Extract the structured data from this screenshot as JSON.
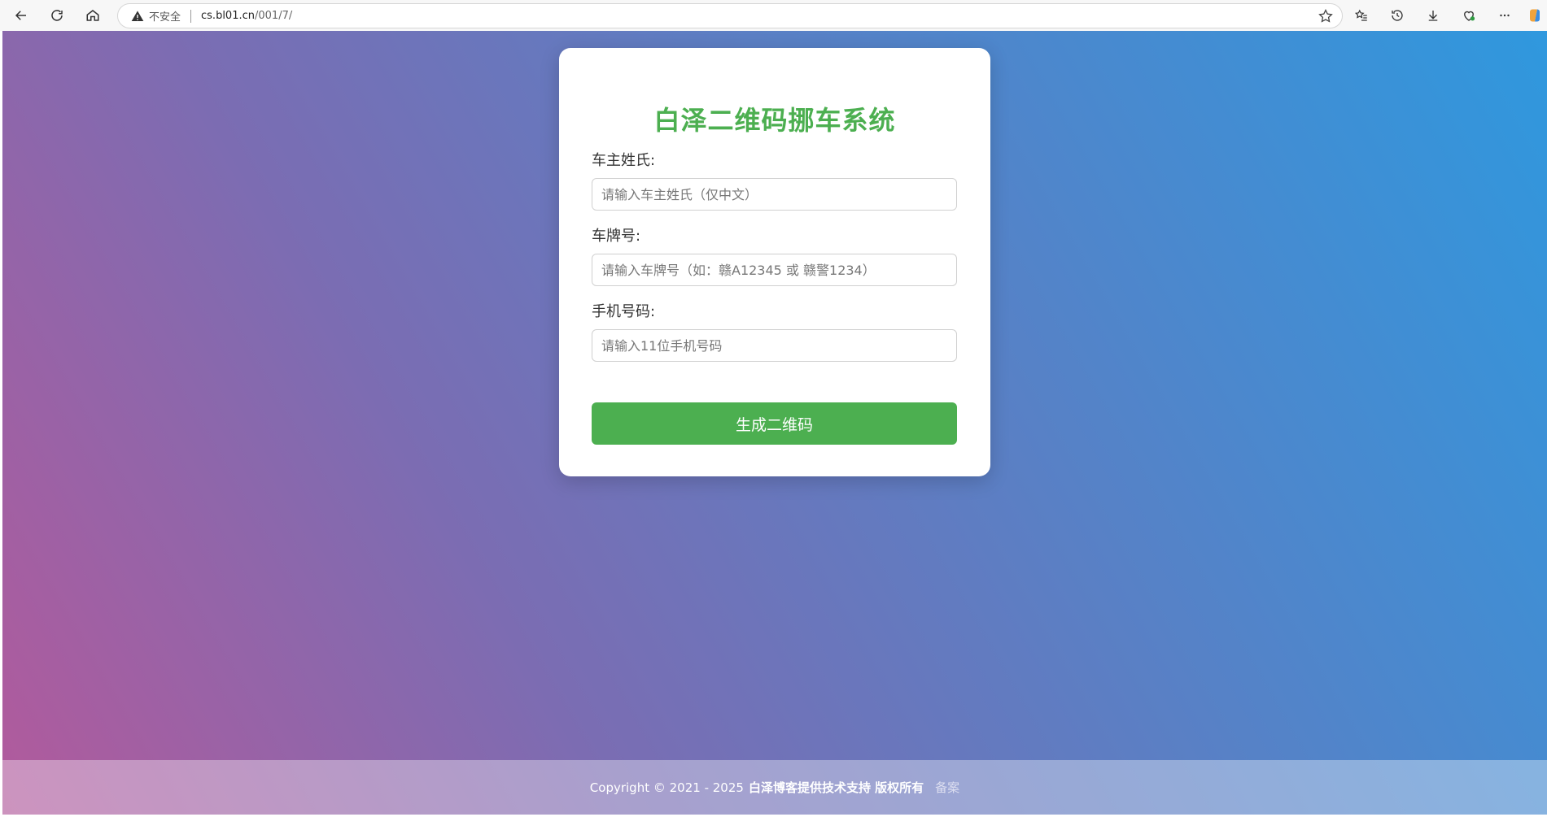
{
  "browser": {
    "not_secure": "不安全",
    "url_host": "cs.bl01.cn",
    "url_path": "/001/7/"
  },
  "card": {
    "title": "白泽二维码挪车系统",
    "fields": [
      {
        "label": "车主姓氏:",
        "placeholder": "请输入车主姓氏（仅中文）",
        "value": ""
      },
      {
        "label": "车牌号:",
        "placeholder": "请输入车牌号（如：赣A12345 或 赣警1234）",
        "value": ""
      },
      {
        "label": "手机号码:",
        "placeholder": "请输入11位手机号码",
        "value": ""
      }
    ],
    "submit_label": "生成二维码"
  },
  "footer": {
    "copyright": "Copyright © 2021 - 2025",
    "support": "白泽博客提供技术支持 版权所有",
    "beian": "备案"
  },
  "colors": {
    "accent": "#4caf50",
    "gradient_start": "#b25a9c",
    "gradient_end": "#2f98de"
  }
}
